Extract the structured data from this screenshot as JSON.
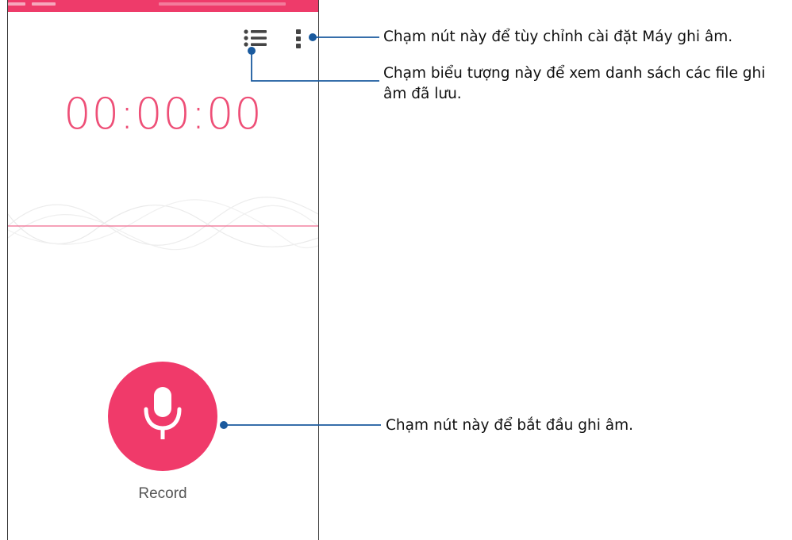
{
  "colors": {
    "accent": "#ee3b6a",
    "timer": "#ee4f77",
    "callout_line": "#1a5a9e"
  },
  "toolbar": {
    "list_icon": "list-icon",
    "more_icon": "more-vertical-icon"
  },
  "recorder": {
    "timer": "00:00:00",
    "record_label": "Record",
    "mic_icon": "microphone-icon"
  },
  "callouts": {
    "settings": "Chạm nút này để tùy chỉnh cài đặt Máy ghi âm.",
    "list": "Chạm biểu tượng này để xem danh sách các file ghi âm đã lưu.",
    "record": "Chạm nút này để bắt đầu ghi âm."
  }
}
